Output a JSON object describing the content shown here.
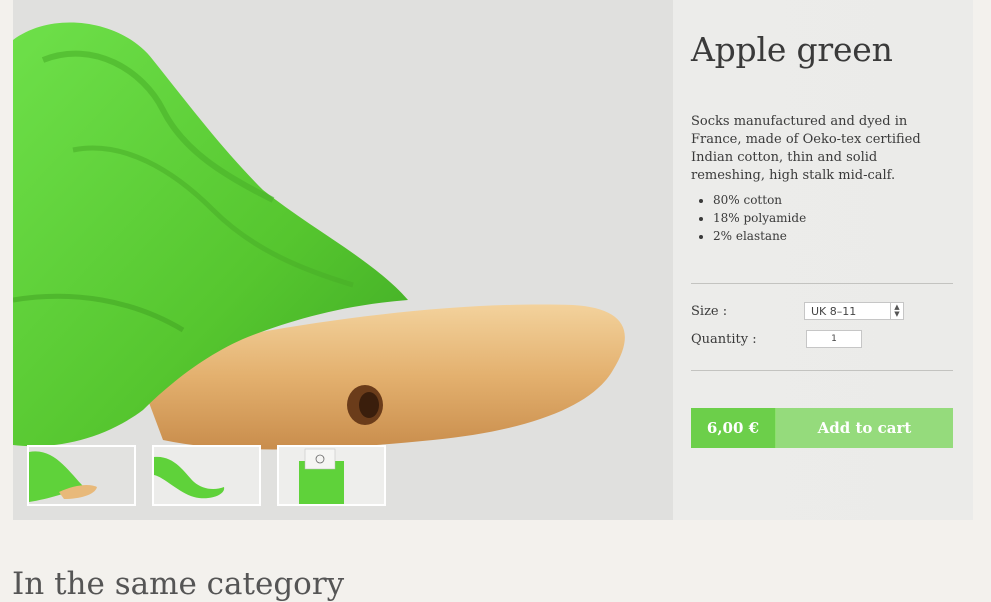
{
  "product": {
    "title": "Apple green",
    "description": "Socks manufactured and dyed in France, made of Oeko-tex certified Indian cotton, thin and solid remeshing, high stalk mid-calf.",
    "composition": [
      "80% cotton",
      "18% polyamide",
      "2% elastane"
    ],
    "size_label": "Size :",
    "size_value": "UK 8–11",
    "quantity_label": "Quantity :",
    "quantity_value": "1",
    "price": "6,00 €",
    "add_to_cart": "Add to cart"
  },
  "section": {
    "same_category_title": "In the same category"
  },
  "colors": {
    "green": "#6ccf4a",
    "green_light": "#95db7c",
    "sock": "#5fd23a",
    "wood": "#e8b97a"
  }
}
